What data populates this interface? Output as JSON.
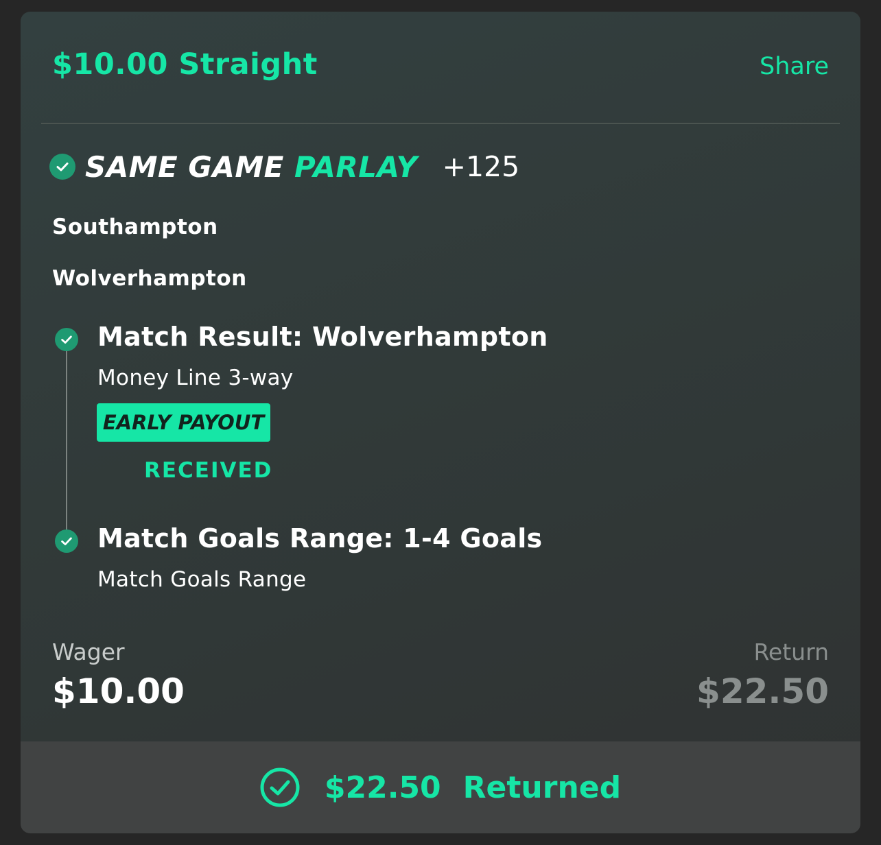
{
  "header": {
    "title": "$10.00 Straight",
    "share_label": "Share"
  },
  "bet": {
    "type_part1": "SAME GAME",
    "type_part2": "PARLAY",
    "odds": "+125",
    "teams": [
      "Southampton",
      "Wolverhampton"
    ]
  },
  "legs": [
    {
      "title": "Match Result: Wolverhampton",
      "market": "Money Line 3-way",
      "badge": "EARLY PAYOUT",
      "badge_status": "RECEIVED",
      "status_icon": "check-circle-icon"
    },
    {
      "title": "Match Goals Range: 1-4 Goals",
      "market": "Match Goals Range",
      "status_icon": "check-circle-icon"
    }
  ],
  "summary": {
    "wager_label": "Wager",
    "wager_value": "$10.00",
    "return_label": "Return",
    "return_value": "$22.50"
  },
  "footer": {
    "icon": "check-circle-outline-icon",
    "amount": "$22.50",
    "status": "Returned"
  },
  "colors": {
    "accent": "#16e6a6",
    "check_fill": "#1f9a72",
    "background": "#262626",
    "card": "#333b3a",
    "footer": "#414343"
  }
}
